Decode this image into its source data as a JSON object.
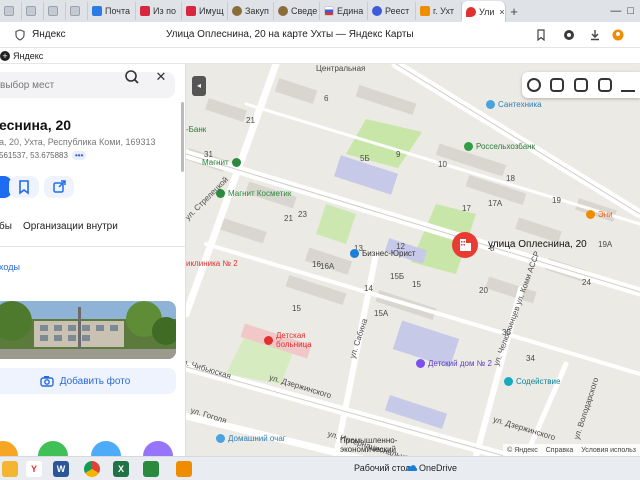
{
  "tabs": [
    {
      "label": "",
      "color": "#9aa3ad"
    },
    {
      "label": "",
      "color": "#9aa3ad"
    },
    {
      "label": "",
      "color": "#9aa3ad"
    },
    {
      "label": "",
      "color": "#9aa3ad"
    },
    {
      "label": "Почта",
      "color": "#2c7be5"
    },
    {
      "label": "Из по",
      "color": "#d7263d"
    },
    {
      "label": "Имущ",
      "color": "#d7263d"
    },
    {
      "label": "Закуп",
      "color": "#8a6d3b"
    },
    {
      "label": "Сведе",
      "color": "#8a6d3b"
    },
    {
      "label": "Едина",
      "color": "#3b5bdb"
    },
    {
      "label": "Реест",
      "color": "#3b5bdb"
    },
    {
      "label": "г. Ухт",
      "color": "#f08c00"
    },
    {
      "label": "Ули",
      "color": "#e03131"
    }
  ],
  "browser": {
    "host": "Яндекс",
    "title": "Улица Оплеснина, 20 на карте Ухты — Яндекс Карты",
    "bookmark": "Яндекс",
    "win_min": "—",
    "win_max": "□",
    "win_close": "✕",
    "new_tab": "+"
  },
  "panel": {
    "search_placeholder": "выбор мест",
    "close": "✕",
    "title": "еснина, 20",
    "address": "а, 20, Ухта, Республика Коми, 169313",
    "coords": "561537, 53.675883",
    "more": "•••",
    "tab_1": "бы",
    "tab_2": "Организации внутри",
    "link": "ходы",
    "add_photo": "Добавить фото"
  },
  "map": {
    "collapse": "◂",
    "pin_label": "улица Оплеснина, 20",
    "pin_icon": "building-icon",
    "streets": [
      {
        "text": "Центральная"
      },
      {
        "text": "ул. Гоголя"
      },
      {
        "text": "ул. Дзержинского"
      },
      {
        "text": "ул. Дзержинского"
      },
      {
        "text": "ул. Сабина"
      },
      {
        "text": "ул. Чибьюская"
      },
      {
        "text": "ул. Интернациональная"
      },
      {
        "text": "ул. Стрелецкой"
      },
      {
        "text": "ул. Володарского"
      },
      {
        "text": "ул. Челюскинцев ул. Коми АССР"
      }
    ],
    "house_numbers": [
      "20",
      "21",
      "21",
      "23",
      "12",
      "13",
      "14",
      "15",
      "15",
      "15Б",
      "15А",
      "17А",
      "17",
      "18",
      "19",
      "19А",
      "5Б",
      "9",
      "10",
      "6",
      "8",
      "16",
      "16А",
      "24",
      "31",
      "34",
      "35"
    ],
    "pois": [
      {
        "text": "Сантехника",
        "color": "#4aa3df"
      },
      {
        "text": "Россельхозбанк",
        "color": "#2f9e44"
      },
      {
        "text": "-Банк",
        "color": "#2f9e44"
      },
      {
        "text": "Магнит",
        "color": "#2b8a3e"
      },
      {
        "text": "Магнит Косметик",
        "color": "#2b8a3e"
      },
      {
        "text": "Бизнес-Юрист",
        "color": "#1c7ed6"
      },
      {
        "text": "иклиника № 2",
        "color": "#e03131"
      },
      {
        "text": "Детская больница",
        "color": "#e03131"
      },
      {
        "text": "Детский дом № 2",
        "color": "#7950f2"
      },
      {
        "text": "Содействие",
        "color": "#15aabf"
      },
      {
        "text": "Домашний очаг",
        "color": "#4aa3df"
      },
      {
        "text": "Промышленно-экономический колледж",
        "color": "#3b5bdb"
      },
      {
        "text": "Эни",
        "color": "#f08c00"
      }
    ],
    "attribution": [
      "© Яндекс",
      "Справка",
      "Условия использ"
    ]
  },
  "taskbar": {
    "desktop_label": "Рабочий стол",
    "onedrive_label": "OneDrive",
    "apps": [
      {
        "name": "Word",
        "color": "#2b579a",
        "glyph": "W"
      },
      {
        "name": "Excel",
        "color": "#217346",
        "glyph": "X"
      }
    ]
  }
}
